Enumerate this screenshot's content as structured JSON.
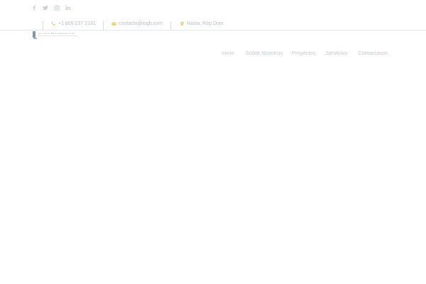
{
  "social": {
    "icons": [
      "facebook-icon",
      "twitter-icon",
      "instagram-icon",
      "linkedin-icon"
    ]
  },
  "contact": {
    "phone": "+1 809 237 2131",
    "email": "contacto@ingb.com",
    "location": "Haina, Rep Dom",
    "icon_color": "#e6cf5c"
  },
  "logo": {
    "text": "Ing. José A. Báez Arquitectura S.R.L."
  },
  "nav": {
    "items": [
      "Inicio",
      "Sobre Nosotros",
      "Proyectos",
      "Servicios",
      "Contactanos"
    ]
  },
  "colors": {
    "text_muted": "#c4c9cf",
    "rule": "#e4e7eb",
    "accent": "#e6cf5c"
  }
}
